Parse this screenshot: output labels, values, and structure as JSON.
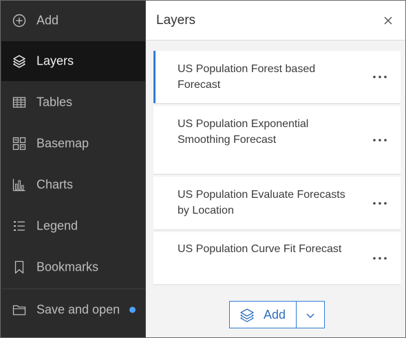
{
  "sidebar": {
    "items": [
      {
        "label": "Add",
        "icon": "plus-circle-icon"
      },
      {
        "label": "Layers",
        "icon": "layers-icon",
        "active": true
      },
      {
        "label": "Tables",
        "icon": "table-icon"
      },
      {
        "label": "Basemap",
        "icon": "basemap-icon"
      },
      {
        "label": "Charts",
        "icon": "chart-icon"
      },
      {
        "label": "Legend",
        "icon": "legend-icon"
      },
      {
        "label": "Bookmarks",
        "icon": "bookmark-icon"
      }
    ],
    "save": {
      "label": "Save and open",
      "icon": "folder-icon",
      "indicator_color": "#4da2f5"
    }
  },
  "panel": {
    "title": "Layers",
    "layers": [
      {
        "title": "US Population Forest based Forecast",
        "selected": true
      },
      {
        "title": "US Population Exponential Smoothing Forecast"
      },
      {
        "title": "US Population Evaluate Forecasts by Location"
      },
      {
        "title": "US Population Curve Fit Forecast"
      }
    ],
    "footer": {
      "add_label": "Add"
    }
  },
  "colors": {
    "sidebar_bg": "#2b2b2b",
    "sidebar_active": "#151515",
    "accent": "#2f7cd6"
  }
}
